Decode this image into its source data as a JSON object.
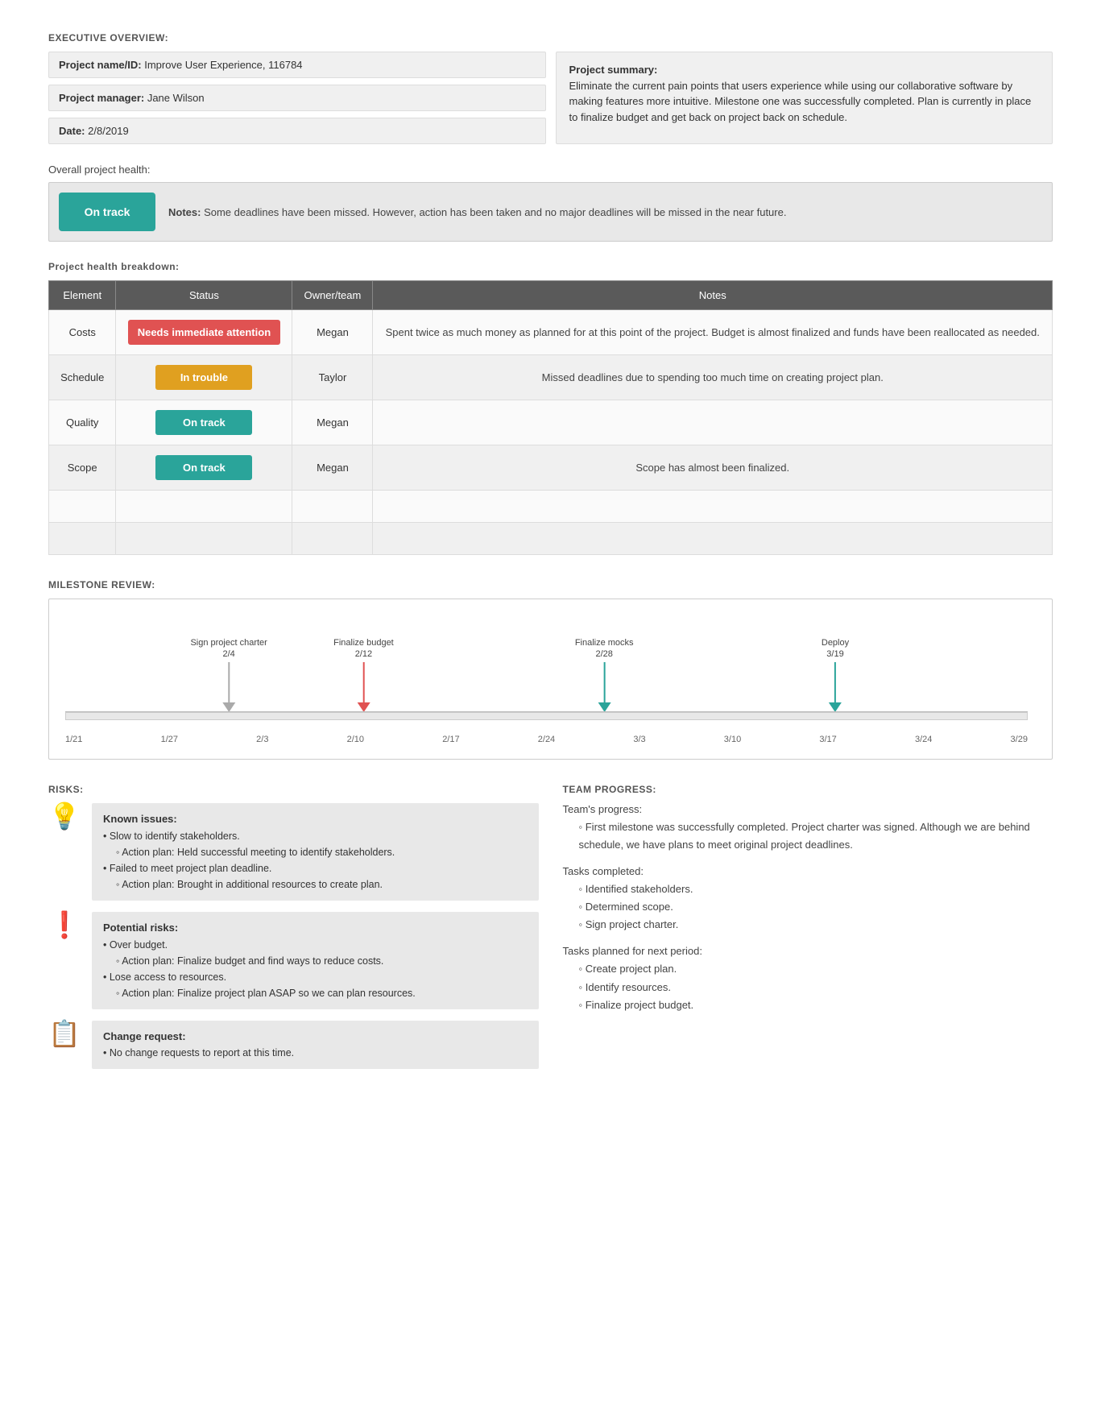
{
  "exec": {
    "section_title": "EXECUTIVE OVERVIEW:",
    "project_name_label": "Project name/ID:",
    "project_name_value": "Improve User Experience, 116784",
    "project_manager_label": "Project manager:",
    "project_manager_value": "Jane Wilson",
    "date_label": "Date:",
    "date_value": "2/8/2019",
    "summary_label": "Project summary:",
    "summary_text": "Eliminate the current pain points that users experience while using our collaborative software by making features more intuitive. Milestone one was successfully completed. Plan is currently in place to finalize budget and get back on project back on schedule."
  },
  "overall_health": {
    "label": "Overall project health:",
    "badge": "On track",
    "notes_label": "Notes:",
    "notes_text": "Some deadlines have been missed. However, action has been taken and no major deadlines will be missed in the near future."
  },
  "breakdown": {
    "section_title": "Project health breakdown:",
    "headers": [
      "Element",
      "Status",
      "Owner/team",
      "Notes"
    ],
    "rows": [
      {
        "element": "Costs",
        "status": "Needs immediate attention",
        "status_type": "red",
        "owner": "Megan",
        "notes": "Spent twice as much money as planned for at this point of the project. Budget is almost finalized and funds have been reallocated as needed."
      },
      {
        "element": "Schedule",
        "status": "In trouble",
        "status_type": "orange",
        "owner": "Taylor",
        "notes": "Missed deadlines due to spending too much time on creating project plan."
      },
      {
        "element": "Quality",
        "status": "On track",
        "status_type": "teal",
        "owner": "Megan",
        "notes": ""
      },
      {
        "element": "Scope",
        "status": "On track",
        "status_type": "teal",
        "owner": "Megan",
        "notes": "Scope has almost been finalized."
      }
    ]
  },
  "milestone": {
    "section_title": "MILESTONE REVIEW:",
    "markers": [
      {
        "label": "Sign project charter",
        "date": "2/4",
        "type": "gray",
        "left_pct": 17
      },
      {
        "label": "Finalize budget",
        "date": "2/12",
        "type": "red",
        "left_pct": 31
      },
      {
        "label": "Finalize mocks",
        "date": "2/28",
        "type": "teal",
        "left_pct": 56
      },
      {
        "label": "Deploy",
        "date": "3/19",
        "type": "teal",
        "left_pct": 80
      }
    ],
    "axis_labels": [
      "1/21",
      "1/27",
      "2/3",
      "2/10",
      "2/17",
      "2/24",
      "3/3",
      "3/10",
      "3/17",
      "3/24",
      "3/29"
    ]
  },
  "risks": {
    "section_title": "RISKS:",
    "items": [
      {
        "icon": "💡",
        "title": "Known issues:",
        "content": [
          "• Slow to identify stakeholders.",
          "◦ Action plan: Held successful meeting to identify stakeholders.",
          "• Failed to meet project plan deadline.",
          "◦ Action plan: Brought in additional resources to create plan."
        ]
      },
      {
        "icon": "❗",
        "title": "Potential risks:",
        "content": [
          "• Over budget.",
          "◦ Action plan: Finalize budget and find ways to reduce costs.",
          "• Lose access to resources.",
          "◦ Action plan: Finalize project plan ASAP so we can plan resources."
        ]
      },
      {
        "icon": "📋",
        "title": "Change request:",
        "content": [
          "• No change requests to report at this time."
        ]
      }
    ]
  },
  "team_progress": {
    "section_title": "TEAM PROGRESS:",
    "progress_label": "Team's progress:",
    "progress_text": "First milestone was successfully completed. Project charter was signed. Although we are behind schedule, we have plans to meet original project deadlines.",
    "tasks_completed_label": "Tasks completed:",
    "tasks_completed": [
      "Identified stakeholders.",
      "Determined scope.",
      "Sign project charter."
    ],
    "tasks_planned_label": "Tasks planned for next period:",
    "tasks_planned": [
      "Create project plan.",
      "Identify resources.",
      "Finalize project budget."
    ]
  }
}
